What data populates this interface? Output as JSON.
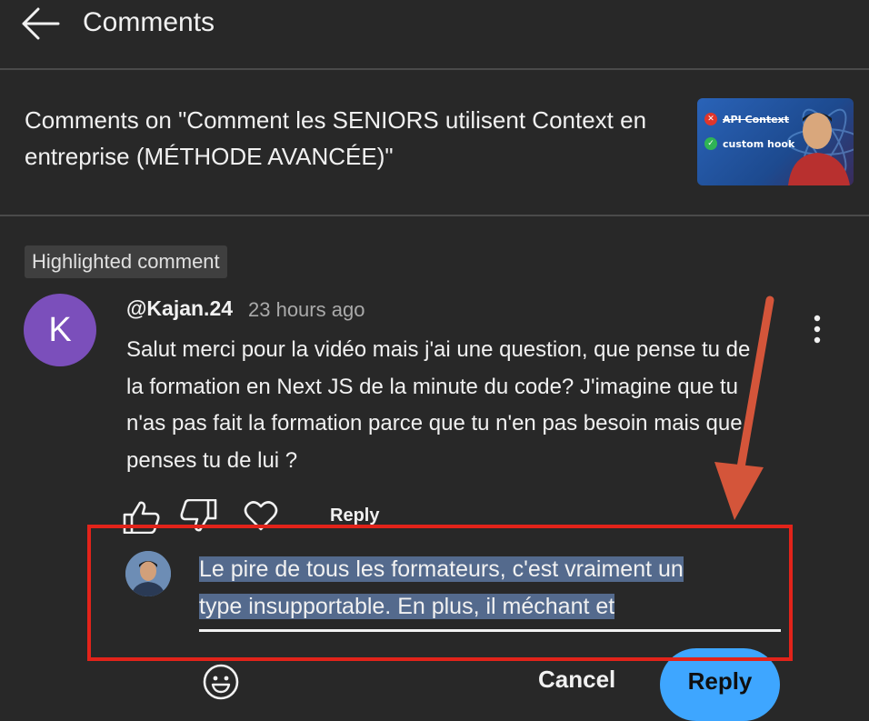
{
  "header": {
    "title": "Comments"
  },
  "video": {
    "title": "Comments on \"Comment les SENIORS utilisent Context en entreprise (MÉTHODE AVANCÉE)\"",
    "thumbnail_line1": "API Context",
    "thumbnail_line2": "custom hook"
  },
  "highlighted_label": "Highlighted comment",
  "comment": {
    "avatar_letter": "K",
    "author": "@Kajan.24",
    "time": "23 hours ago",
    "text": "Salut merci pour la vidéo mais j'ai une question, que pense tu de la formation en Next JS de la minute du code? J'imagine que tu n'as pas fait la formation parce que tu n'en pas besoin mais que penses tu de lui ?",
    "reply_link": "Reply"
  },
  "reply_box": {
    "value_line1": "Le pire de tous les formateurs, c'est vraiment un",
    "value_line2": "type insupportable. En plus, il méchant et",
    "cancel_label": "Cancel",
    "reply_label": "Reply"
  },
  "colors": {
    "background": "#282828",
    "annotation_red": "#e2231a",
    "arrow_orange": "#d4553a",
    "reply_button": "#3ea6ff",
    "selection": "#546a8d"
  },
  "icons": [
    "back-arrow-icon",
    "more-vert-icon",
    "like-icon",
    "dislike-icon",
    "heart-icon",
    "emoji-icon"
  ]
}
